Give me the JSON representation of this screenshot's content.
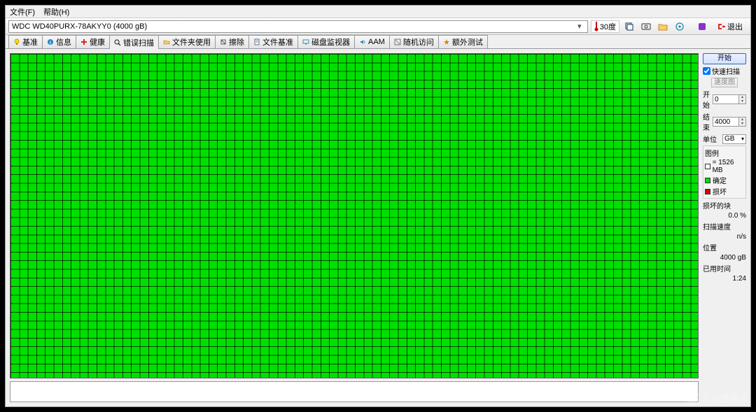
{
  "menu": {
    "file": "文件(F)",
    "help": "帮助(H)"
  },
  "toolbar": {
    "drive": "WDC WD40PURX-78AKYY0 (4000 gB)",
    "temp": "30度",
    "exit": "退出"
  },
  "tabs": [
    {
      "label": "基准",
      "icon": "lightbulb"
    },
    {
      "label": "信息",
      "icon": "info"
    },
    {
      "label": "健康",
      "icon": "plus"
    },
    {
      "label": "错误扫描",
      "icon": "search",
      "active": true
    },
    {
      "label": "文件夹使用",
      "icon": "folder"
    },
    {
      "label": "擦除",
      "icon": "erase"
    },
    {
      "label": "文件基准",
      "icon": "doc"
    },
    {
      "label": "磁盘监视器",
      "icon": "monitor"
    },
    {
      "label": "AAM",
      "icon": "sound"
    },
    {
      "label": "随机访问",
      "icon": "random"
    },
    {
      "label": "额外测试",
      "icon": "extra"
    }
  ],
  "side": {
    "start": "开始",
    "quick_scan": "快速扫描",
    "map_btn": "速度图",
    "start_label": "开始",
    "start_val": "0",
    "end_label": "结束",
    "end_val": "4000",
    "unit_label": "单位",
    "unit_val": "GB",
    "legend_title": "图例",
    "legend_block_size": "= 1526 MB",
    "legend_ok": "确定",
    "legend_bad": "损坏",
    "damaged_label": "损坏的块",
    "damaged_val": "0.0 %",
    "speed_label": "扫描速度",
    "speed_val": "n/s",
    "pos_label": "位置",
    "pos_val": "4000 gB",
    "elapsed_label": "已用时间",
    "elapsed_val": "1:24"
  },
  "watermark": {
    "badge": "值",
    "text": "什么值得买"
  }
}
